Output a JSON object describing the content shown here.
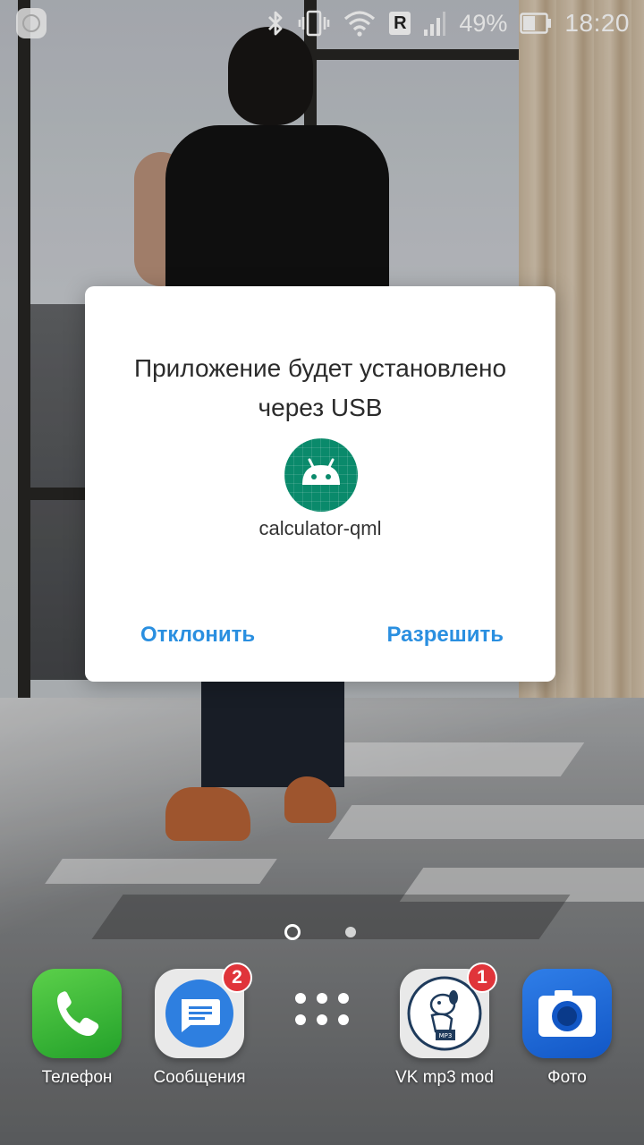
{
  "status_bar": {
    "battery_percent": "49%",
    "time": "18:20",
    "network_badge": "R",
    "icons": [
      "notification-app-icon",
      "bluetooth-icon",
      "vibrate-icon",
      "wifi-icon",
      "roaming-icon",
      "signal-icon",
      "battery-icon"
    ]
  },
  "dialog": {
    "title": "Приложение будет установлено через USB",
    "app_name": "calculator-qml",
    "app_icon": "android-icon",
    "app_icon_color": "#0a8a6b",
    "decline_label": "Отклонить",
    "allow_label": "Разрешить",
    "button_color": "#2a8fe0"
  },
  "home": {
    "pages": 2,
    "active_page": 1
  },
  "dock": {
    "items": [
      {
        "label": "Телефон",
        "icon": "phone-icon",
        "badge": ""
      },
      {
        "label": "Сообщения",
        "icon": "messages-icon",
        "badge": "2"
      },
      {
        "label": "",
        "icon": "app-drawer-icon",
        "badge": ""
      },
      {
        "label": "VK mp3 mod",
        "icon": "vk-mp3-icon",
        "badge": "1"
      },
      {
        "label": "Фото",
        "icon": "camera-icon",
        "badge": ""
      }
    ]
  }
}
